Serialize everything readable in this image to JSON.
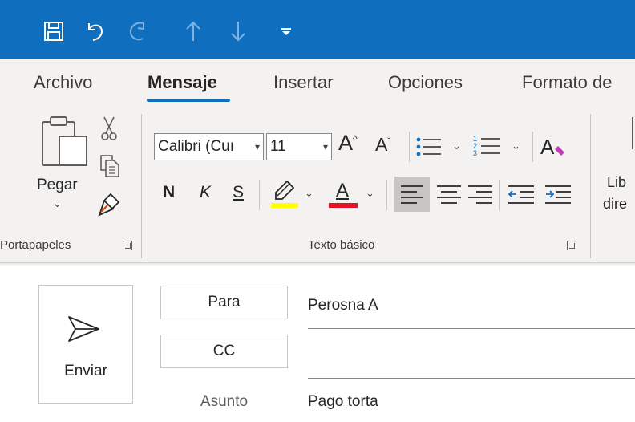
{
  "quick_access": {
    "icons": [
      "save-icon",
      "undo-icon",
      "redo-icon",
      "move-up-icon",
      "move-down-icon",
      "customize-icon"
    ],
    "bar_color": "#106ebe"
  },
  "tabs": [
    {
      "label": "Archivo",
      "active": false
    },
    {
      "label": "Mensaje",
      "active": true
    },
    {
      "label": "Insertar",
      "active": false
    },
    {
      "label": "Opciones",
      "active": false
    },
    {
      "label": "Formato de",
      "active": false
    }
  ],
  "ribbon": {
    "clipboard": {
      "paste_label": "Pegar",
      "group_label": "Portapapeles"
    },
    "basic_text": {
      "font_name": "Calibri (Cuı",
      "font_size": "11",
      "bold": "N",
      "italic": "K",
      "underline": "S",
      "group_label": "Texto básico"
    },
    "next_group": {
      "line1": "Lib",
      "line2": "dire"
    },
    "highlight_color": "#ffff00",
    "font_color": "#e81123"
  },
  "message": {
    "send_label": "Enviar",
    "to_label": "Para",
    "to_value": "Perosna A",
    "cc_label": "CC",
    "cc_value": "",
    "subject_label": "Asunto",
    "subject_value": "Pago torta"
  }
}
